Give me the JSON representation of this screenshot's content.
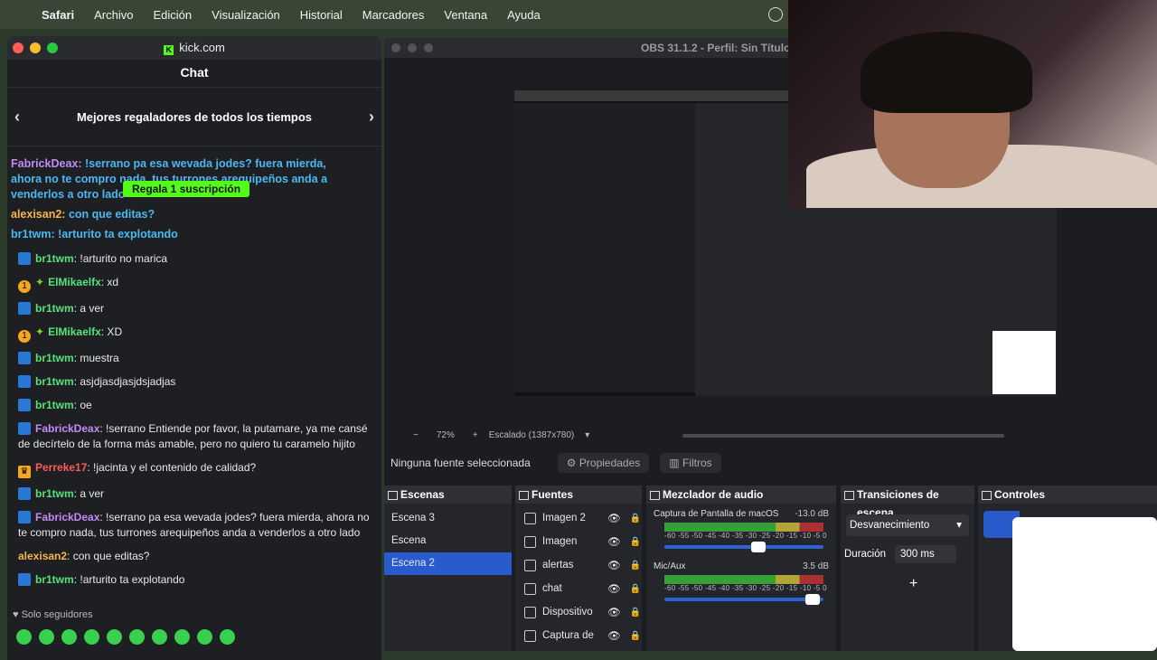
{
  "menubar": {
    "items": [
      "Safari",
      "Archivo",
      "Edición",
      "Visualización",
      "Historial",
      "Marcadores",
      "Ventana",
      "Ayuda"
    ]
  },
  "safari": {
    "url": "kick.com",
    "chat_title": "Chat",
    "gifters_title": "Mejores regaladores de todos los tiempos",
    "pinned": {
      "line1_user": "FabrickDeax:",
      "line1_text": " !serrano pa esa wevada jodes? fuera mierda,",
      "line2": "ahora no te compro nada, tus turrones arequipeños anda a",
      "line3": "venderlos a otro lado",
      "gift_button": "Regala 1 suscripción",
      "alex_user": "alexisan2:",
      "alex_text": " con que editas?",
      "br_user": "br1twm:",
      "br_text": " !arturito ta explotando"
    },
    "messages": [
      {
        "user": "br1twm",
        "text": ": !arturito no marica"
      },
      {
        "user": "ElMikaelfx",
        "text": ": xd"
      },
      {
        "user": "br1twm",
        "text": ": a ver"
      },
      {
        "user": "ElMikaelfx",
        "text": ": XD"
      },
      {
        "user": "br1twm",
        "text": ": muestra"
      },
      {
        "user": "br1twm",
        "text": ": asjdjasdjasjdsjadjas"
      },
      {
        "user": "br1twm",
        "text": ": oe"
      },
      {
        "user": "FabrickDeax",
        "text": ": !serrano Entiende por favor, la putamare, ya me cansé de decírtelo de la forma más amable, pero no quiero tu caramelo hijito"
      },
      {
        "user": "Perreke17",
        "text": ": !jacinta y el contenido de calidad?"
      },
      {
        "user": "br1twm",
        "text": ": a ver"
      },
      {
        "user": "FabrickDeax",
        "text": ": !serrano pa esa wevada jodes? fuera mierda, ahora no te compro nada, tus turrones arequipeños anda a venderlos a otro lado"
      },
      {
        "user": "alexisan2",
        "text": ": con que editas?"
      },
      {
        "user": "br1twm",
        "text": ": !arturito ta explotando"
      }
    ],
    "solo": "Solo seguidores"
  },
  "obs": {
    "title": "OBS 31.1.2 - Perfil: Sin Título",
    "zoom": "72%",
    "scaling": "Escalado (1387x780)",
    "no_source": "Ninguna fuente seleccionada",
    "properties": "Propiedades",
    "filters": "Filtros",
    "scenes_title": "Escenas",
    "scenes": [
      "Escena 3",
      "Escena",
      "Escena 2"
    ],
    "sources_title": "Fuentes",
    "sources": [
      "Imagen 2",
      "Imagen",
      "alertas",
      "chat",
      "Dispositivo",
      "Captura de"
    ],
    "mixer_title": "Mezclador de audio",
    "ch1_name": "Captura de Pantalla de macOS",
    "ch1_db": "-13.0 dB",
    "ch2_name": "Mic/Aux",
    "ch2_db": "3.5 dB",
    "meter_scale": "-60 -55 -50 -45 -40 -35 -30 -25 -20 -15 -10 -5 0",
    "transitions_title": "Transiciones de escena",
    "transition": "Desvanecimiento",
    "duration_label": "Duración",
    "duration": "300 ms",
    "controls_title": "Controles"
  }
}
